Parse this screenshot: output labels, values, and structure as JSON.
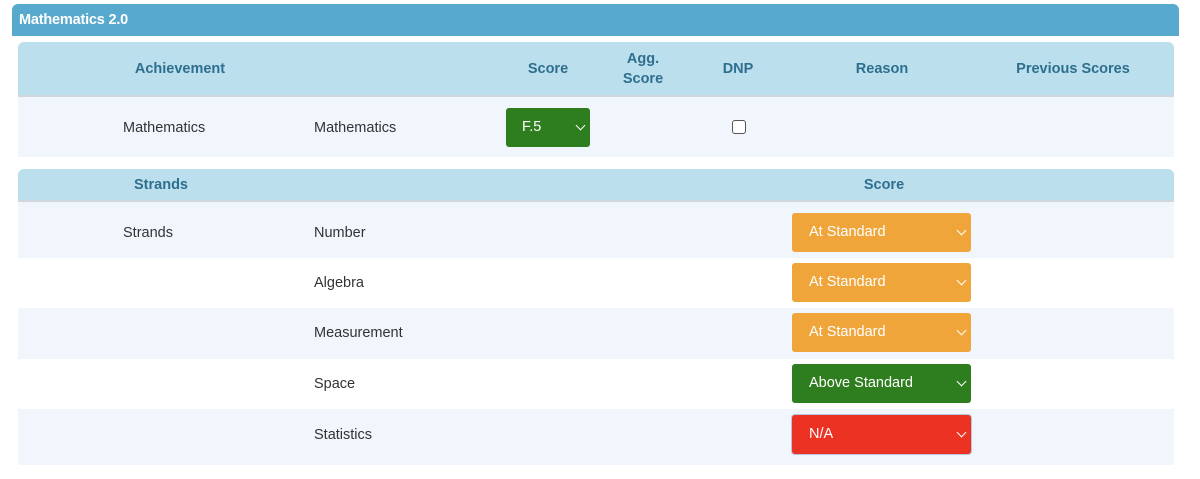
{
  "panel": {
    "title": "Mathematics 2.0"
  },
  "achievement_header": {
    "achievement": "Achievement",
    "score": "Score",
    "agg_score_line1": "Agg.",
    "agg_score_line2": "Score",
    "dnp": "DNP",
    "reason": "Reason",
    "previous_scores": "Previous Scores"
  },
  "achievement_row": {
    "achievement": "Mathematics",
    "subject": "Mathematics",
    "score_value": "F.5",
    "dnp_checked": false
  },
  "strands_header": {
    "strands": "Strands",
    "score": "Score"
  },
  "strands": [
    {
      "group": "Strands",
      "name": "Number",
      "score": "At Standard",
      "color": "#f0a53a"
    },
    {
      "group": "",
      "name": "Algebra",
      "score": "At Standard",
      "color": "#f0a53a"
    },
    {
      "group": "",
      "name": "Measurement",
      "score": "At Standard",
      "color": "#f0a53a"
    },
    {
      "group": "",
      "name": "Space",
      "score": "Above Standard",
      "color": "#2e7d1e"
    },
    {
      "group": "",
      "name": "Statistics",
      "score": "N/A",
      "color": "#ec3223"
    }
  ],
  "colors": {
    "header_blue": "#57a9cd",
    "table_header": "#bcdfee",
    "score_green": "#2e7d1e",
    "at_standard": "#f0a53a",
    "na_red": "#ec3223"
  }
}
